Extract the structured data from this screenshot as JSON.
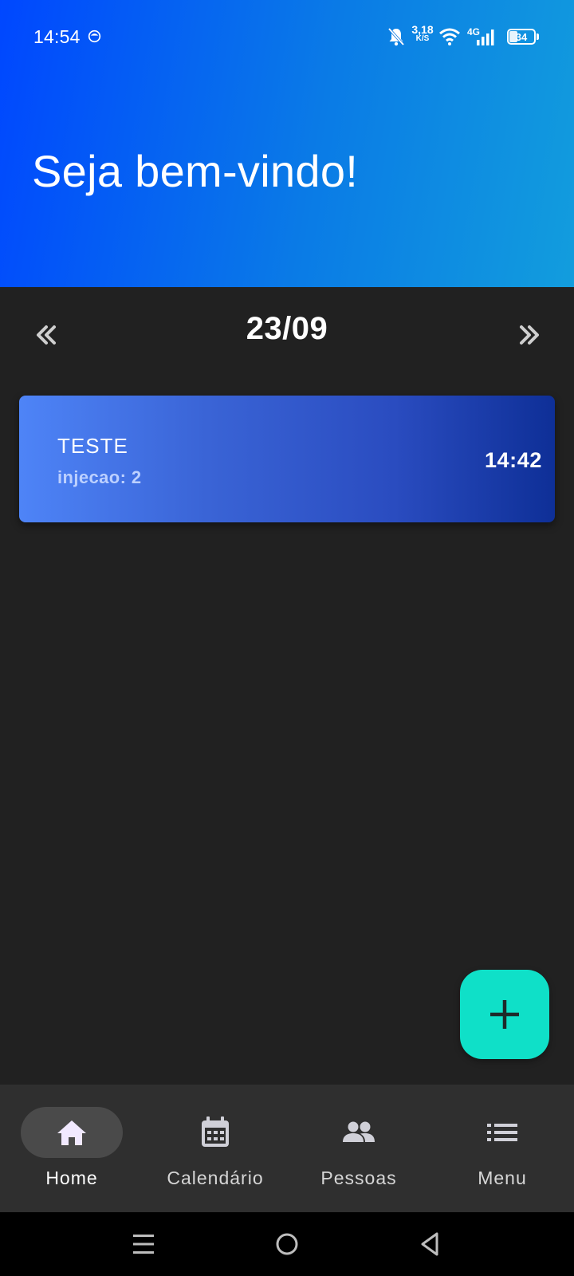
{
  "status_bar": {
    "time": "14:54",
    "network_speed_value": "3,18",
    "network_speed_unit": "K/S",
    "network_type": "4G",
    "battery": "34"
  },
  "header": {
    "welcome": "Seja bem-vindo!",
    "gradient": [
      "#0047ff",
      "#129ddd"
    ]
  },
  "date_nav": {
    "date": "23/09",
    "prev_icon": "chevron-double-left-icon",
    "next_icon": "chevron-double-right-icon"
  },
  "events": [
    {
      "title": "TESTE",
      "subtitle": "injecao: 2",
      "time": "14:42"
    }
  ],
  "fab": {
    "icon": "plus-icon",
    "color": "#0fe0c8"
  },
  "bottom_nav": {
    "items": [
      {
        "label": "Home",
        "icon": "home-icon",
        "active": true
      },
      {
        "label": "Calendário",
        "icon": "calendar-icon",
        "active": false
      },
      {
        "label": "Pessoas",
        "icon": "people-icon",
        "active": false
      },
      {
        "label": "Menu",
        "icon": "list-icon",
        "active": false
      }
    ]
  },
  "system_nav": {
    "icons": [
      "recents-icon",
      "home-circle-icon",
      "back-triangle-icon"
    ]
  }
}
